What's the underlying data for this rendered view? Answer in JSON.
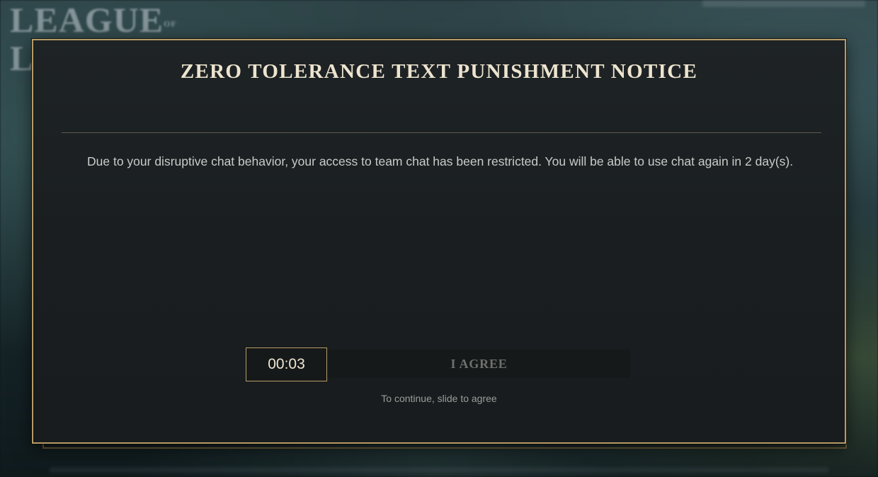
{
  "background": {
    "logo_text_line1": "LEAGUE",
    "logo_text_of": "OF",
    "logo_text_line2": "L"
  },
  "modal": {
    "title": "ZERO TOLERANCE TEXT PUNISHMENT NOTICE",
    "message": "Due to your disruptive chat behavior, your access to team chat has been restricted. You will be able to use chat again in 2 day(s).",
    "timer": "00:03",
    "agree_label": "I AGREE",
    "hint": "To continue, slide to agree"
  },
  "colors": {
    "border_gold": "#b79b66",
    "panel_bg": "#1c2022",
    "title_text": "#ede4cf"
  }
}
